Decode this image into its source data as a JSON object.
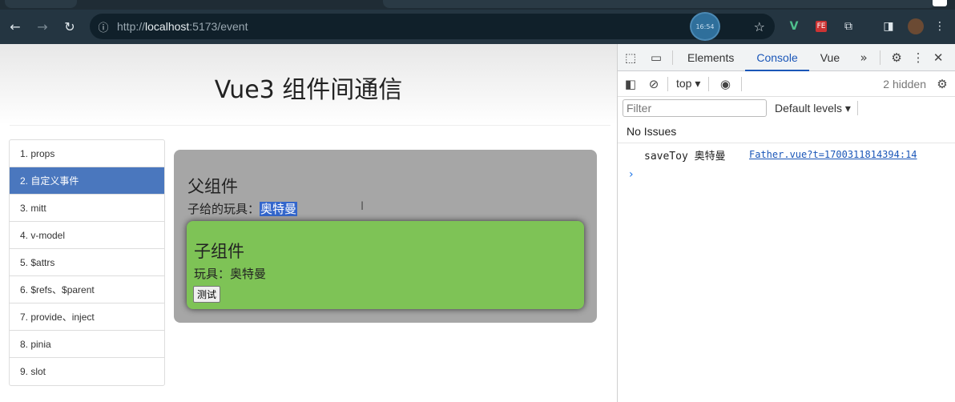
{
  "browser": {
    "url_prefix": "http://",
    "url_host": "localhost",
    "url_rest": ":5173/event",
    "clock_text": "16:54",
    "icons": [
      "back-icon",
      "forward-icon",
      "reload-icon",
      "info-icon",
      "star-icon"
    ],
    "extensions": [
      "vue-devtools-icon",
      "fe-helper-icon",
      "puzzle-icon",
      "sidebar-icon",
      "avatar"
    ]
  },
  "page": {
    "title": "Vue3 组件间通信",
    "nav": [
      "1. props",
      "2. 自定义事件",
      "3. mitt",
      "4. v-model",
      "5. $attrs",
      "6. $refs、$parent",
      "7. provide、inject",
      "8. pinia",
      "9. slot"
    ],
    "active_index": 1,
    "father": {
      "heading": "父组件",
      "toy_label": "子给的玩具：",
      "toy_value": "奥特曼"
    },
    "child": {
      "heading": "子组件",
      "toy_line": "玩具：奥特曼",
      "button": "测试"
    }
  },
  "devtools": {
    "tabs": [
      "Elements",
      "Console",
      "Vue"
    ],
    "active_tab": "Console",
    "context": "top",
    "hidden": "2 hidden",
    "filter_placeholder": "Filter",
    "levels": "Default levels",
    "issues": "No Issues",
    "log": {
      "message": "saveToy 奥特曼",
      "source": "Father.vue?t=1700311814394:14"
    }
  },
  "colors": {
    "chrome": "#243541",
    "nav_active": "#4a77be",
    "father_bg": "#a6a6a6",
    "child_bg": "#7ec356",
    "devtools_accent": "#1a56b8"
  }
}
